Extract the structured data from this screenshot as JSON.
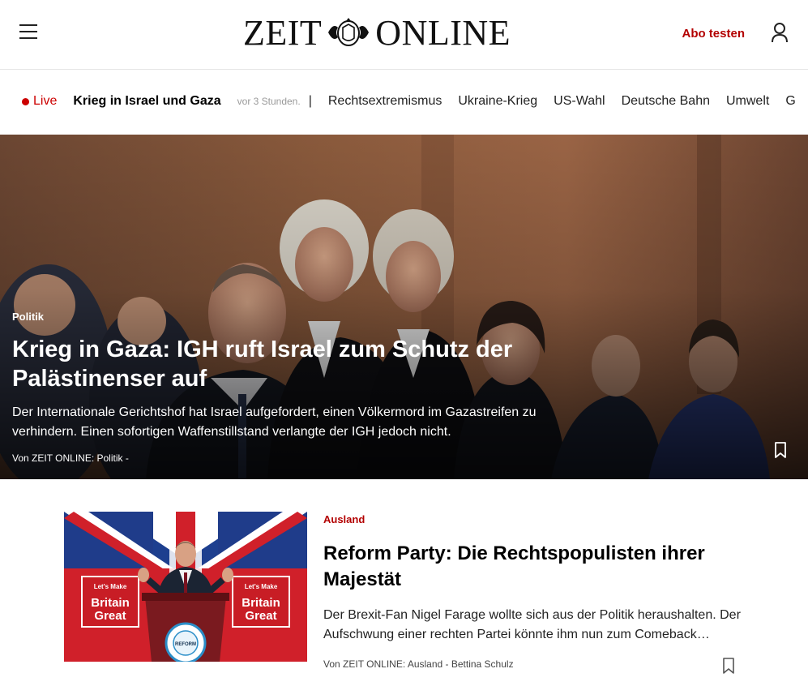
{
  "header": {
    "logo_left": "ZEIT",
    "logo_right": "ONLINE",
    "abo_label": "Abo testen"
  },
  "topics": {
    "live_label": "Live",
    "lead_topic": "Krieg in Israel und Gaza",
    "time": "vor 3 Stunden.",
    "separator": "|",
    "items": [
      "Rechtsextremismus",
      "Ukraine-Krieg",
      "US-Wahl",
      "Deutsche Bahn",
      "Umwelt",
      "G"
    ]
  },
  "hero": {
    "kicker": "Politik",
    "title": "Krieg in Gaza: IGH ruft Israel zum Schutz der Palästinenser auf",
    "teaser": "Der Internationale Gerichtshof hat Israel aufgefordert, einen Völkermord im Gazastreifen zu verhindern. Einen sofortigen Waffenstillstand verlangte der IGH jedoch nicht.",
    "byline": "Von ZEIT ONLINE: Politik -"
  },
  "article": {
    "kicker": "Ausland",
    "title": "Reform Party: Die Rechtspopulisten ihrer Majestät",
    "teaser": "Der Brexit-Fan Nigel Farage wollte sich aus der Politik heraushalten. Der Aufschwung einer rechten Partei könnte ihm nun zum Comeback…",
    "byline": "Von ZEIT ONLINE: Ausland - Bettina Schulz",
    "image_text": {
      "sign_line1": "Let's Make",
      "sign_line2": "Britain",
      "sign_line3": "Great",
      "podium": "REFORM"
    }
  },
  "colors": {
    "accent_red": "#b30000",
    "live_red": "#cc0000"
  },
  "icons": [
    "menu-icon",
    "user-icon",
    "bookmark-icon",
    "zeit-seal-icon"
  ]
}
